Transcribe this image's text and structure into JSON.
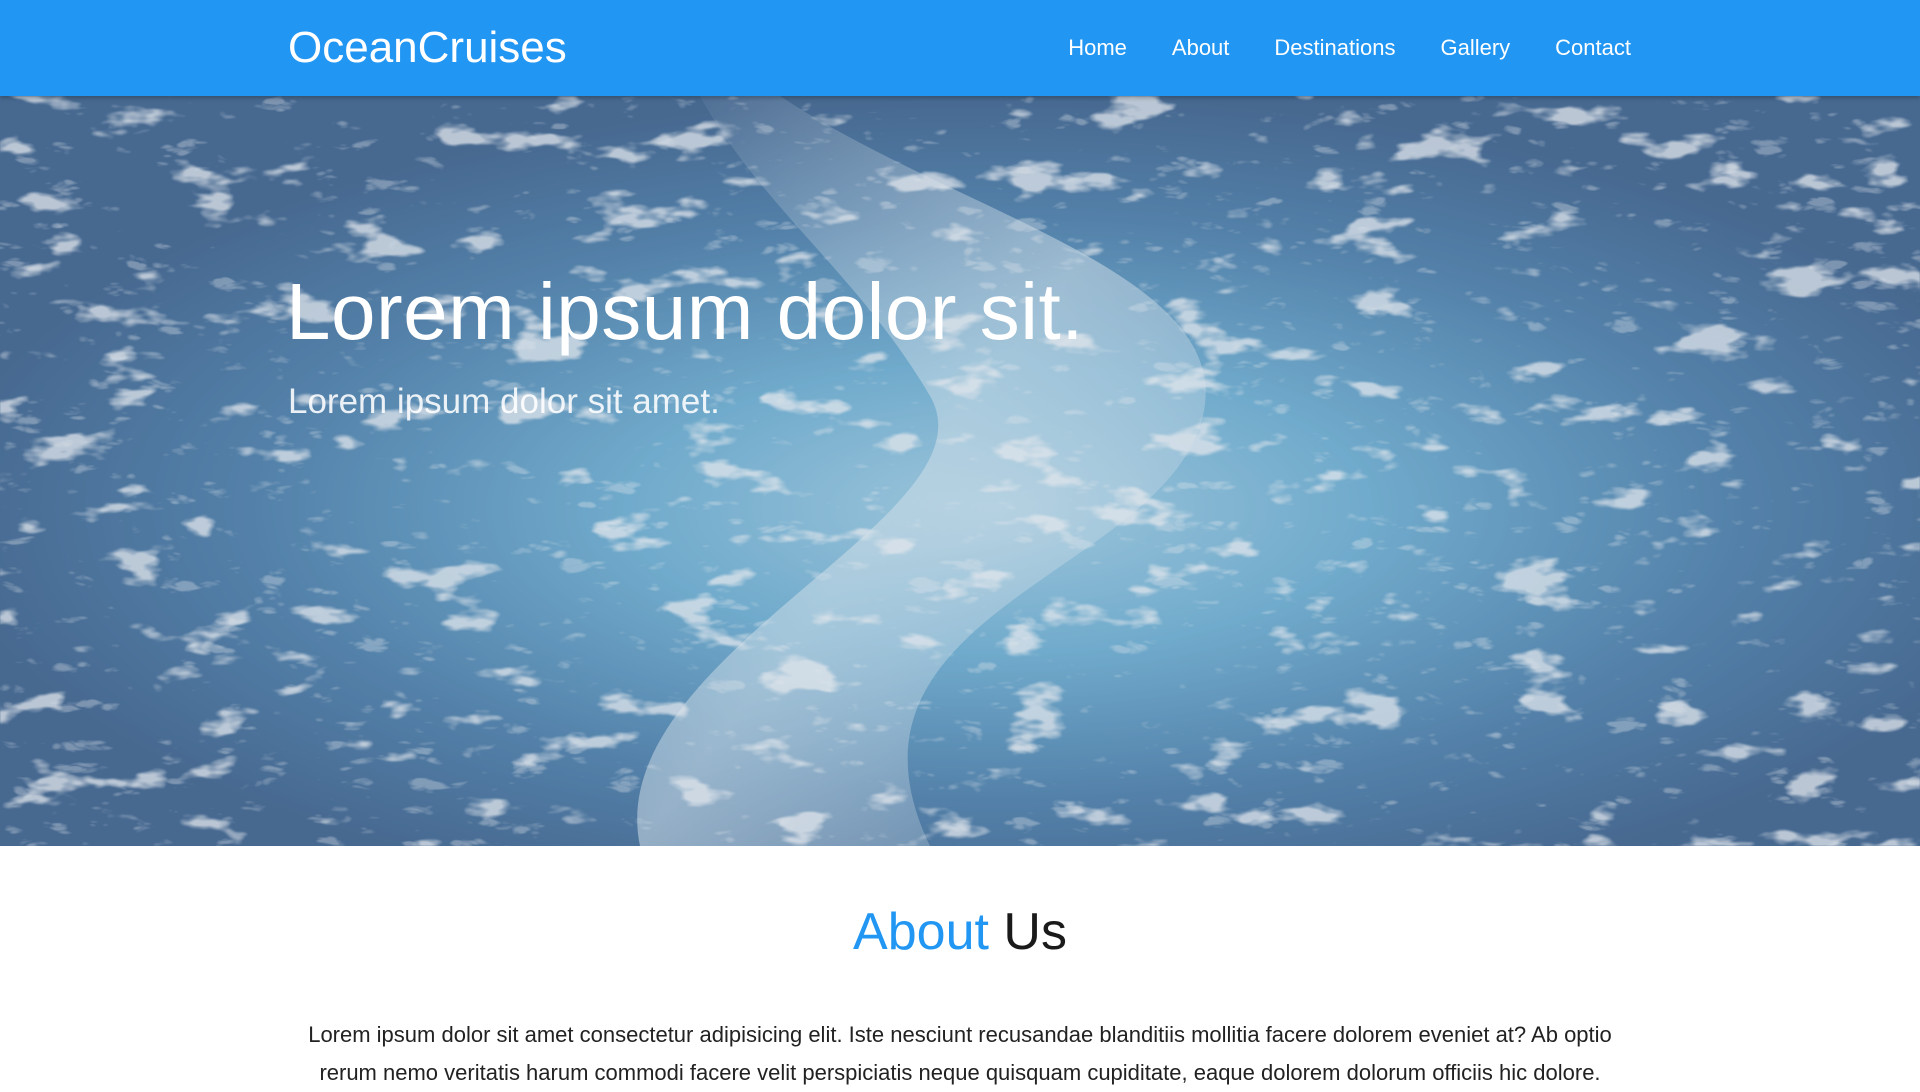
{
  "colors": {
    "brand": "#2196f3",
    "hero_water": "#3e6a95",
    "text_dark": "#1a1a1a"
  },
  "navbar": {
    "brand": "OceanCruises",
    "links": [
      {
        "label": "Home"
      },
      {
        "label": "About"
      },
      {
        "label": "Destinations"
      },
      {
        "label": "Gallery"
      },
      {
        "label": "Contact"
      }
    ]
  },
  "hero": {
    "title": "Lorem ipsum dolor sit.",
    "subtitle": "Lorem ipsum dolor sit amet.",
    "background_image": "ocean-wake-photo"
  },
  "about": {
    "title_accent": "About",
    "title_rest": "Us",
    "text": "Lorem ipsum dolor sit amet consectetur adipisicing elit. Iste nesciunt recusandae blanditiis mollitia facere dolorem eveniet at? Ab optio rerum nemo veritatis harum commodi facere velit perspiciatis neque quisquam cupiditate, eaque dolorem dolorum officiis hic dolore."
  }
}
